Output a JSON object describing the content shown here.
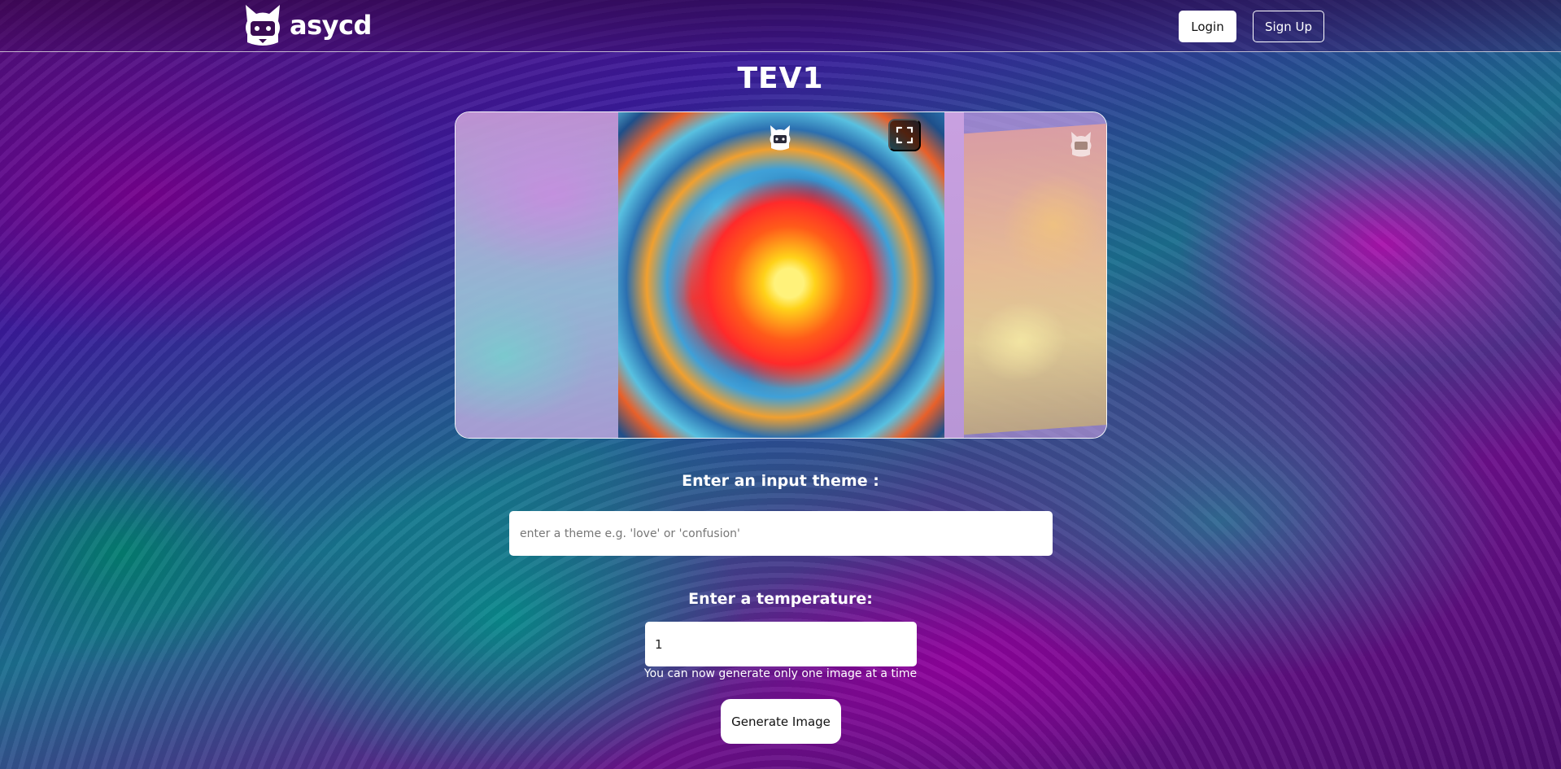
{
  "header": {
    "brand_name": "asycd",
    "login_label": "Login",
    "signup_label": "Sign Up"
  },
  "page": {
    "title": "TEV1"
  },
  "carousel": {
    "icons": [
      "cat-logo-watermark-icon",
      "fullscreen-icon"
    ]
  },
  "form": {
    "theme_label": "Enter an input theme :",
    "theme_placeholder": "enter a theme e.g. 'love' or 'confusion'",
    "temperature_label": "Enter a temperature:",
    "temperature_value": "1",
    "hint": "You can now generate only one image at a time",
    "generate_label": "Generate Image"
  },
  "colors": {
    "button_bg": "#ffffff",
    "text": "#ffffff"
  }
}
